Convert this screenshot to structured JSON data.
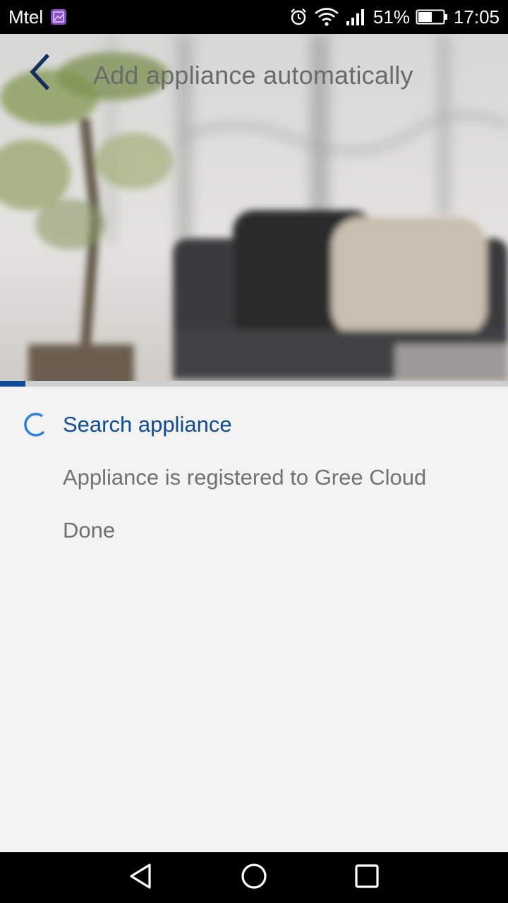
{
  "status_bar": {
    "carrier": "Mtel",
    "battery_percent": "51%",
    "time": "17:05",
    "icons": [
      "gallery-icon",
      "alarm-icon",
      "wifi-icon",
      "signal-icon",
      "battery-icon"
    ]
  },
  "app_bar": {
    "title": "Add appliance automatically",
    "back_icon": "chevron-left-icon"
  },
  "progress": {
    "fraction": 0.05,
    "color": "#0f4c97"
  },
  "steps": [
    {
      "label": "Search appliance",
      "state": "active",
      "indicator": "spinner-icon"
    },
    {
      "label": "Appliance is registered to Gree Cloud",
      "state": "pending"
    },
    {
      "label": "Done",
      "state": "pending"
    }
  ],
  "nav_bar": {
    "buttons": [
      "back-triangle-icon",
      "home-circle-icon",
      "recents-square-icon"
    ]
  },
  "colors": {
    "accent": "#0f4c97",
    "spinner": "#2f7fe0",
    "text_muted": "#727272",
    "background": "#f3f3f3"
  }
}
